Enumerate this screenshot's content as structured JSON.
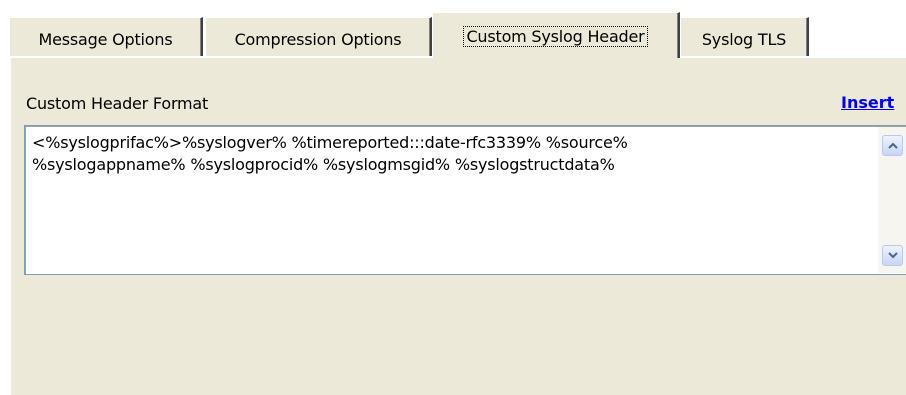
{
  "tabs": [
    {
      "label": "Message Options",
      "active": false
    },
    {
      "label": "Compression Options",
      "active": false
    },
    {
      "label": "Custom Syslog Header",
      "active": true
    },
    {
      "label": "Syslog TLS",
      "active": false
    }
  ],
  "header_format": {
    "label": "Custom Header Format",
    "insert_link": "Insert",
    "value": "<%syslogprifac%>%syslogver% %timereported:::date-rfc3339% %source%\n%syslogappname% %syslogprocid% %syslogmsgid% %syslogstructdata%"
  },
  "colors": {
    "panel": "#ece9d8",
    "link": "#0000ff",
    "field_border": "#7f9db9"
  },
  "icons": {
    "scroll_up": "chevron-up-icon",
    "scroll_down": "chevron-down-icon"
  }
}
